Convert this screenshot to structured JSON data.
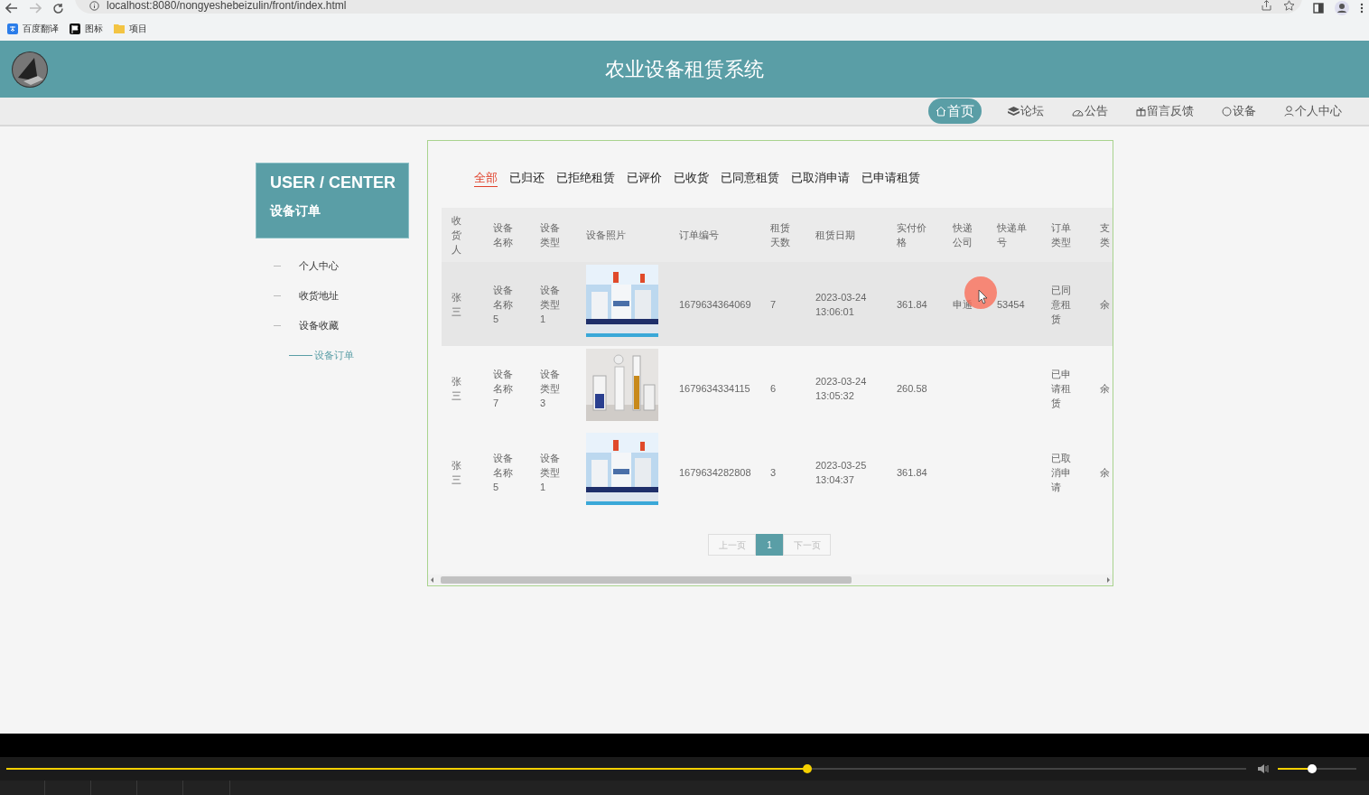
{
  "browser": {
    "url": "localhost:8080/nongyeshebeizulin/front/index.html",
    "bookmarks": [
      {
        "label": "百度翻译",
        "kind": "translate"
      },
      {
        "label": "图标",
        "kind": "flag"
      },
      {
        "label": "项目",
        "kind": "folder"
      }
    ]
  },
  "header": {
    "title": "农业设备租赁系统"
  },
  "nav": [
    {
      "label": "首页",
      "selected": true
    },
    {
      "label": "论坛",
      "selected": false
    },
    {
      "label": "公告",
      "selected": false
    },
    {
      "label": "留言反馈",
      "selected": false
    },
    {
      "label": "设备",
      "selected": false
    },
    {
      "label": "个人中心",
      "selected": false
    }
  ],
  "sidebar": {
    "title": "USER / CENTER",
    "subtitle": "设备订单",
    "items": [
      {
        "label": "个人中心",
        "selected": false
      },
      {
        "label": "收货地址",
        "selected": false
      },
      {
        "label": "设备收藏",
        "selected": false
      },
      {
        "label": "设备订单",
        "selected": true
      }
    ]
  },
  "filters": [
    {
      "label": "全部",
      "selected": true
    },
    {
      "label": "已归还",
      "selected": false
    },
    {
      "label": "已拒绝租赁",
      "selected": false
    },
    {
      "label": "已评价",
      "selected": false
    },
    {
      "label": "已收货",
      "selected": false
    },
    {
      "label": "已同意租赁",
      "selected": false
    },
    {
      "label": "已取消申请",
      "selected": false
    },
    {
      "label": "已申请租赁",
      "selected": false
    }
  ],
  "table": {
    "columns": [
      "收货人",
      "设备名称",
      "设备类型",
      "设备照片",
      "订单编号",
      "租赁天数",
      "租赁日期",
      "实付价格",
      "快递公司",
      "快递单号",
      "订单类型",
      "支类"
    ],
    "rows": [
      {
        "hovered": true,
        "receiver": "张三",
        "name": "设备名称5",
        "type": "设备类型1",
        "order_no": "1679634364069",
        "days": "7",
        "date": "2023-03-24 13:06:01",
        "price": "361.84",
        "courier": "申通",
        "tracking": "53454",
        "order_type": "已同意租赁",
        "pay_type": "余"
      },
      {
        "hovered": false,
        "receiver": "张三",
        "name": "设备名称7",
        "type": "设备类型3",
        "order_no": "1679634334115",
        "days": "6",
        "date": "2023-03-24 13:05:32",
        "price": "260.58",
        "order_type": "已申请租赁",
        "pay_type": "余"
      },
      {
        "hovered": false,
        "receiver": "张三",
        "name": "设备名称5",
        "type": "设备类型1",
        "order_no": "1679634282808",
        "days": "3",
        "date": "2023-03-25 13:04:37",
        "price": "361.84",
        "order_type": "已取消申请",
        "pay_type": "余"
      }
    ]
  },
  "pagination": {
    "prev": "上一页",
    "pages": [
      {
        "label": "1",
        "selected": true
      }
    ],
    "next": "下一页"
  },
  "player": {
    "progress": {
      "level": 0.646
    },
    "volume": {
      "level": 0.44
    }
  }
}
